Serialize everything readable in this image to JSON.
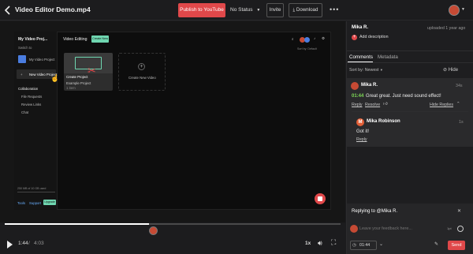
{
  "header": {
    "back_icon": "chevron-left-icon",
    "title": "Video Editor Demo.mp4",
    "publish_label": "Publish to YouTube",
    "status_label": "No Status",
    "invite_label": "Invite",
    "download_label": "Download",
    "more_icon": "ellipsis-icon"
  },
  "video_frame": {
    "project_menu": "My Video Proj...",
    "switch_to": "Switch to",
    "project_1": "My Video Project",
    "new_project": "New Video Project",
    "collaboration": "Collaboration",
    "file_requests": "File Requests",
    "review_links": "Review Links",
    "chat": "Chat",
    "storage": "250 MB of 10 GB used",
    "folder": "Video Editing",
    "create_new": "Create New",
    "sort_by": "Sort by: Default",
    "card_title": "Create Project",
    "card_subtitle": "Example Project",
    "card_meta": "1 item",
    "create_new_video": "Create New Video",
    "footer_1": "Tools",
    "footer_2": "Support",
    "footer_3": "Upgrade"
  },
  "player": {
    "progress": 0.43,
    "current_time": "1:44",
    "separator": "/",
    "duration": "4:03",
    "speed": "1x"
  },
  "panel": {
    "user": "Mika R.",
    "uploaded": "uploaded 1 year ago",
    "add_description": "Add description",
    "tab_comments": "Comments",
    "tab_metadata": "Metadata",
    "sort": "Sort by: Newest",
    "hide": "Hide",
    "comments": [
      {
        "author": "Mika R.",
        "age": "34s",
        "timecode": "01:44",
        "text": "Great great. Just need sound effect!",
        "reply": "Reply",
        "resolve": "Resolve",
        "hide_replies": "Hide Replies"
      }
    ],
    "replies": [
      {
        "author": "Mika Robinson",
        "initial": "M",
        "age": "1s",
        "text": "Got it!",
        "reply": "Reply"
      }
    ],
    "reply_box": {
      "title": "Replying to @Mika R.",
      "placeholder": "Leave your feedback here...",
      "toggle_label": "1pt",
      "timecode": "01:44",
      "send": "Send"
    }
  },
  "colors": {
    "accent": "#e0484a",
    "timecode": "#7ed957",
    "avatar": "#c64a34",
    "link": "#c8c8c8"
  }
}
